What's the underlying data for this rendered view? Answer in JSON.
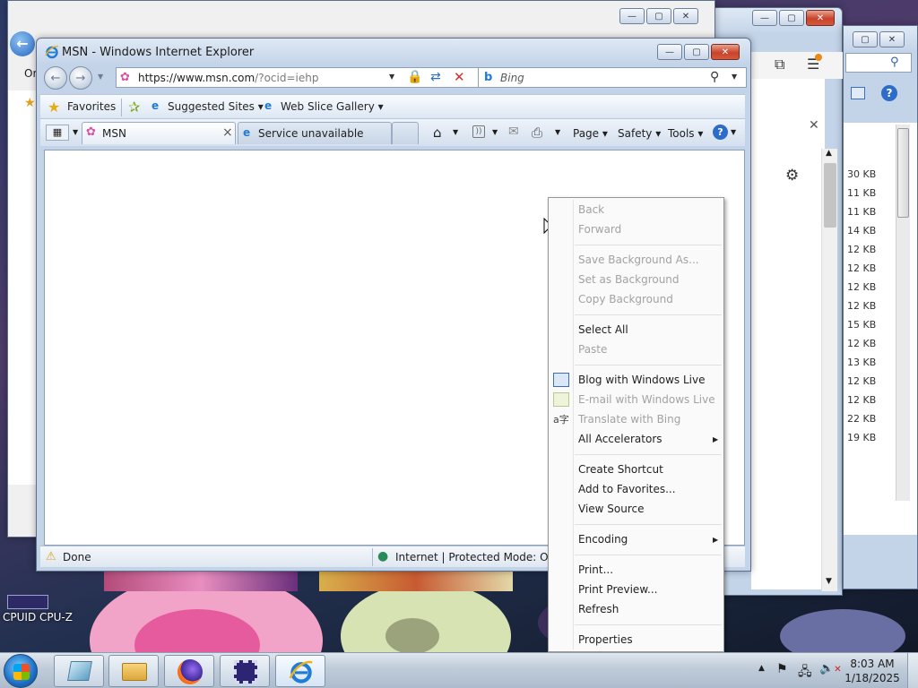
{
  "desktop": {
    "icon_label": "CPUID CPU-Z"
  },
  "background_windows": {
    "left_fragment_text": "Or",
    "file_sizes": [
      "30 KB",
      "11 KB",
      "11 KB",
      "14 KB",
      "12 KB",
      "12 KB",
      "12 KB",
      "12 KB",
      "15 KB",
      "12 KB",
      "13 KB",
      "12 KB",
      "12 KB",
      "22 KB",
      "19 KB"
    ]
  },
  "ie": {
    "title": "MSN - Windows Internet Explorer",
    "address_host": "https://www.msn.com",
    "address_query": "/?ocid=iehp",
    "search_placeholder": "Bing",
    "favorites_label": "Favorites",
    "suggested_sites": "Suggested Sites",
    "web_slice_gallery": "Web Slice Gallery",
    "tabs": [
      {
        "label": "MSN",
        "active": true
      },
      {
        "label": "Service unavailable",
        "active": false
      }
    ],
    "tab_close": "×",
    "commands": {
      "page": "Page",
      "safety": "Safety",
      "tools": "Tools"
    },
    "status_left": "Done",
    "status_zone": "Internet | Protected Mode: Off"
  },
  "context_menu": {
    "items": [
      {
        "label": "Back",
        "disabled": true
      },
      {
        "label": "Forward",
        "disabled": true
      },
      {
        "label": "Save Background As...",
        "disabled": true
      },
      {
        "label": "Set as Background",
        "disabled": true
      },
      {
        "label": "Copy Background",
        "disabled": true
      },
      {
        "label": "Select All",
        "disabled": false
      },
      {
        "label": "Paste",
        "disabled": true
      },
      {
        "label": "Blog with Windows Live",
        "disabled": false
      },
      {
        "label": "E-mail with Windows Live",
        "disabled": true
      },
      {
        "label": "Translate with Bing",
        "disabled": true
      },
      {
        "label": "All Accelerators",
        "disabled": false,
        "submenu": true
      },
      {
        "label": "Create Shortcut",
        "disabled": false
      },
      {
        "label": "Add to Favorites...",
        "disabled": false
      },
      {
        "label": "View Source",
        "disabled": false
      },
      {
        "label": "Encoding",
        "disabled": false,
        "submenu": true
      },
      {
        "label": "Print...",
        "disabled": false
      },
      {
        "label": "Print Preview...",
        "disabled": false
      },
      {
        "label": "Refresh",
        "disabled": false
      },
      {
        "label": "Properties",
        "disabled": false
      }
    ]
  },
  "taskbar": {
    "time": "8:03 AM",
    "date": "1/18/2025"
  },
  "colors": {
    "accent": "#3b7ec9",
    "close_red": "#c9432b"
  }
}
